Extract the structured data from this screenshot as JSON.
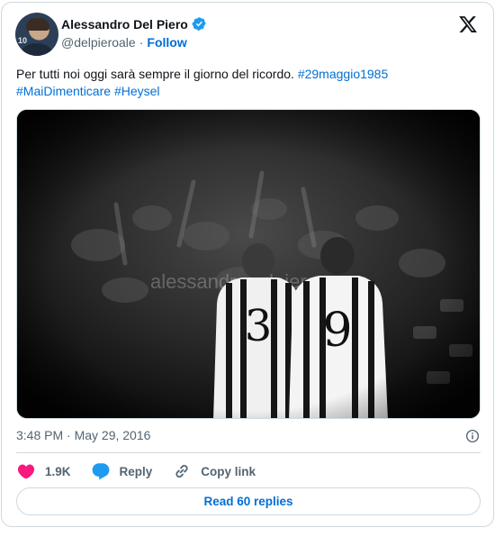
{
  "author": {
    "name": "Alessandro Del Piero",
    "handle": "@delpieroale",
    "separator": "·",
    "follow_label": "Follow",
    "verified_color": "#1d9bf0"
  },
  "tweet": {
    "text_plain": "Per tutti noi oggi sarà sempre il giorno del ricordo.",
    "hashtags": [
      "#29maggio1985",
      "#MaiDimenticare",
      "#Heysel"
    ]
  },
  "media": {
    "watermark": "alessandrodelpiero",
    "jersey_left_number": "3",
    "jersey_right_number": "9"
  },
  "meta": {
    "timestamp": "3:48 PM · May 29, 2016"
  },
  "actions": {
    "like_count": "1.9K",
    "reply_label": "Reply",
    "copy_link_label": "Copy link",
    "like_color": "#f91880",
    "reply_color": "#1d9bf0"
  },
  "read_replies_label": "Read 60 replies",
  "icons": [
    "verified-badge-icon",
    "x-logo-icon",
    "info-icon",
    "heart-icon",
    "reply-bubble-icon",
    "link-icon"
  ]
}
